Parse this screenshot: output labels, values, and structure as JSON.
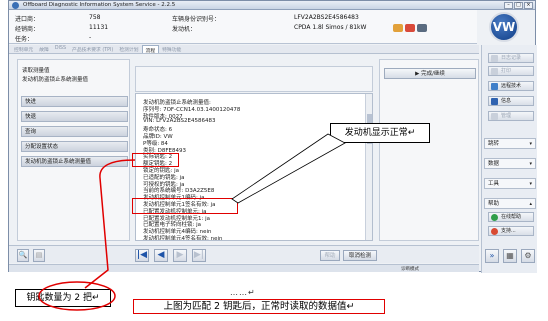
{
  "window": {
    "title": "Offboard Diagnostic Information System Service - 2.2.5"
  },
  "info": {
    "order_label": "进口商：",
    "order_value": "758",
    "dealer_label": "经销商：",
    "dealer_value": "11131",
    "job_label": "任务：",
    "job_value": "-",
    "vin_label": "车辆身份识别号：",
    "vin_value": "LFV2A2BS2E4586483",
    "engine_label": "发动机：",
    "engine_value": "CPDA 1.8l Simos / 81kW"
  },
  "tabs": [
    {
      "label": "控制单元"
    },
    {
      "label": "故障"
    },
    {
      "label": "DISS"
    },
    {
      "label": "产品技术要求 (TPI)"
    },
    {
      "label": "检测计划"
    },
    {
      "label": "流程"
    },
    {
      "label": "特殊功能"
    }
  ],
  "sidebar": {
    "heading": "读取测量值",
    "subheading": "发动机防盗锁止系统测量值",
    "items": [
      {
        "label": "快进"
      },
      {
        "label": "快退"
      },
      {
        "label": "查询"
      },
      {
        "label": "分配设置状态"
      },
      {
        "label": "发动机防盗锁止系统测量值"
      }
    ]
  },
  "content": {
    "lines": [
      "发动机防盗锁止系统测量值:",
      "序列号: 7OF-CCN14.03.1400120478",
      "软件版本: 0027",
      "VIN: LFV2A2BS2E4586483",
      "寿命状态: 6",
      "品牌ID: VW",
      "P等级: 84",
      "类别: D8FE8493",
      "实际钥匙: 2",
      "额定钥匙: 2",
      "锁定的钥匙: ja",
      "已适配的钥匙: ja",
      "可授权的钥匙: ja",
      "当前的系统编号: D3A2Z5E8",
      "发动机控制单元1编码: ja",
      "发动机控制单元1签名有效: ja",
      "已配置发动机控制单元: ja",
      "已配置发动机控制单元1: ja",
      "已配置电子转向柱锁: ja",
      "发动机控制单元4编码: nein",
      "发动机控制单元4签名有效: nein"
    ]
  },
  "right_panel": {
    "done_button": "完成/继续"
  },
  "right_column": {
    "buttons": [
      {
        "label": "日志记录"
      },
      {
        "label": "打印"
      },
      {
        "label": "远程技术"
      },
      {
        "label": "信息"
      },
      {
        "label": "管理"
      }
    ],
    "selects": [
      {
        "label": "跳转"
      },
      {
        "label": "数据"
      },
      {
        "label": "工具"
      },
      {
        "label": "帮助"
      }
    ],
    "help_buttons": [
      {
        "label": "在线帮助"
      },
      {
        "label": "支持..."
      }
    ]
  },
  "bottom": {
    "help_button": "帮助",
    "cancel_button": "取消检测"
  },
  "status": {
    "text": "诊断模式"
  },
  "annotations": {
    "engine_ok": "发动机显示正常↵",
    "key_count": "钥匙数量为 2 把↵",
    "dots": "……↵",
    "caption": "上图为匹配 2 钥匙后，正常时读取的数据值↵"
  },
  "colors": {
    "annotation_red": "#e00000",
    "vw_blue": "#0e3c86",
    "nav_blue": "#1f54a8"
  }
}
